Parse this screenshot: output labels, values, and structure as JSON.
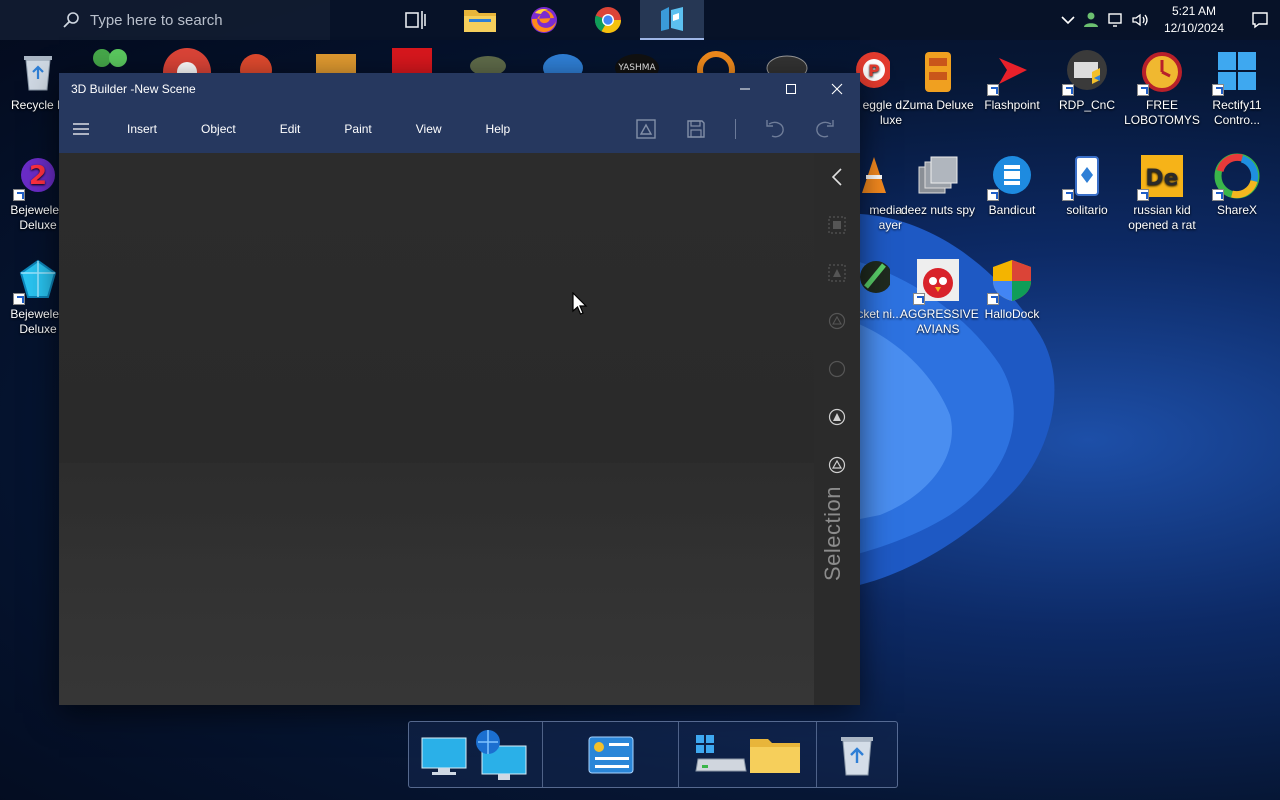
{
  "taskbar": {
    "search_placeholder": "Type here to search",
    "pinned": [
      "task-view",
      "file-explorer",
      "firefox",
      "chrome",
      "3d-builder"
    ],
    "clock_time": "5:21 AM",
    "clock_date": "12/10/2024"
  },
  "desktop": {
    "icons": [
      {
        "label": "Recycle B",
        "icon": "recycle-bin-icon"
      },
      {
        "label": "Bejeweled Deluxe",
        "icon": "bejeweled-2-icon"
      },
      {
        "label": "Bejeweled Deluxe",
        "icon": "bejeweled-icon"
      },
      {
        "label": "eggle d luxe",
        "icon": "peggle-icon"
      },
      {
        "label": "Zuma Deluxe",
        "icon": "zuma-icon"
      },
      {
        "label": "Flashpoint",
        "icon": "flashpoint-icon"
      },
      {
        "label": "RDP_CnC",
        "icon": "rdp-icon"
      },
      {
        "label": "FREE LOBOTOMYS",
        "icon": "clock-icon"
      },
      {
        "label": "Rectify11 Contro...",
        "icon": "rectify11-icon"
      },
      {
        "label": "media ayer",
        "icon": "vlc-icon"
      },
      {
        "label": "deez nuts spy",
        "icon": "windows-stack-icon"
      },
      {
        "label": "Bandicut",
        "icon": "bandicut-icon"
      },
      {
        "label": "solitario",
        "icon": "solitario-icon"
      },
      {
        "label": "russian kid opened a rat",
        "icon": "de-icon"
      },
      {
        "label": "ShareX",
        "icon": "sharex-icon"
      },
      {
        "label": "cket ni...",
        "icon": "rocket-icon"
      },
      {
        "label": "AGGRESSIVE AVIANS",
        "icon": "angry-bird-icon"
      },
      {
        "label": "HalloDock",
        "icon": "shield-icon"
      }
    ]
  },
  "window": {
    "title": "3D Builder -New Scene",
    "menu": [
      "Insert",
      "Object",
      "Edit",
      "Paint",
      "View",
      "Help"
    ],
    "side_label": "Selection"
  },
  "colors": {
    "titlebar": "#26385f",
    "viewport": "#2c2c2c",
    "taskbar": "#08122a"
  }
}
